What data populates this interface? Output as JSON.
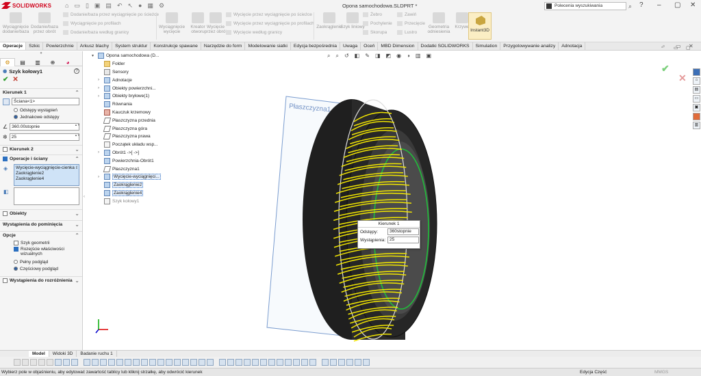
{
  "app": {
    "logo_text": "SOLIDWORKS",
    "doc_title": "Opona samochodowa.SLDPRT *"
  },
  "search": {
    "placeholder": "Polecenia wyszukiwania"
  },
  "ribbon": {
    "b1": "Wyciągnięcie dodanie/baza",
    "b2": "Dodanie/baza przez obrót",
    "s1": "Dodanie/baza przez wyciągnięcie po ścieżce",
    "s2": "Wyciągnięcie po profilach",
    "s3": "Dodanie/baza według granicy",
    "b3": "Wyciągnięcie wycięcie",
    "b4": "Kreator otworu",
    "b5": "Wycięcie przez obrót",
    "s4": "Wycięcie przez wyciągnięcie po ścieżce",
    "s5": "Wycięcie przez wyciągnięcie po profilach",
    "s6": "Wycięcie według granicy",
    "b6": "Zaokrąglenie",
    "b7": "Szyk liniowy",
    "s7": "Żebro",
    "s8": "Pochylenie",
    "s9": "Skorupa",
    "s10": "Zawiń",
    "s11": "Przecięcie",
    "s12": "Lustro",
    "b8": "Geometria odniesienia",
    "b9": "Krzywe",
    "instant3d": "Instant3D"
  },
  "command_tabs": [
    "Operacje",
    "Szkic",
    "Powierzchnie",
    "Arkusz blachy",
    "System struktur",
    "Konstrukcje spawane",
    "Narzędzie do form",
    "Modelowanie siatki",
    "Edycja bezpośrednia",
    "Uwaga",
    "Oceń",
    "MBD Dimension",
    "Dodatki SOLIDWORKS",
    "Simulation",
    "Przygotowywanie analizy",
    "Adnotacja"
  ],
  "property_manager": {
    "title": "Szyk kołowy1",
    "direction1": {
      "header": "Kierunek 1",
      "axis": "Ściana<1>",
      "radio_spacing": "Odstępy wystąpień",
      "radio_equal": "Jednakowe odstępy",
      "angle": "360.00stopnie",
      "count": "25"
    },
    "direction2": {
      "header": "Kierunek 2"
    },
    "features": {
      "header": "Operacje i ściany",
      "items": [
        "Wycięcie-wyciągnięcie-cienka ści",
        "Zaokrąglenie2",
        "Zaokrąglenie4"
      ]
    },
    "bodies": "Obiekty",
    "skip": "Wystąpienia do pominięcia",
    "options": {
      "header": "Opcje",
      "geometry_pattern": "Szyk geometrii",
      "propagate": "Rozejście właściwości wizualnych",
      "full_preview": "Pełny podgląd",
      "partial_preview": "Częściowy podgląd"
    },
    "vary": "Wystąpienia do rozróżnienia"
  },
  "tree": {
    "root": "Opona samochodowa (D...",
    "items": [
      "Folder",
      "Sensory",
      "Adnotacje",
      "Obiekty powierzchni...",
      "Obiekty bryłowe(1)",
      "Równania",
      "Kauczuk krzemowy",
      "Płaszczyzna przednia",
      "Płaszczyzna góra",
      "Płaszczyzna prawa",
      "Początek układu wsp...",
      "Obrót1 ->[ ->]",
      "Powierzchnia-Obrót1",
      "Płaszczyzna1",
      "Wycięcie-wyciągnięci...",
      "Zaokrąglenie2",
      "Zaokrąglenie4",
      "Szyk kołowy1"
    ]
  },
  "viewport": {
    "plane_label": "Płaszczyzna1"
  },
  "callout": {
    "title": "Kierunek 1",
    "spacing_label": "Odstępy:",
    "spacing_value": "360stopnie",
    "count_label": "Wystąpienia:",
    "count_value": "25"
  },
  "model_tabs": [
    "Model",
    "Widoki 3D",
    "Badanie ruchu 1"
  ],
  "status": {
    "message": "Wybierz pole w objaśnieniu, aby edytować zawartość tablicy lub kliknij strzałkę, aby odwrócić kierunek",
    "mode": "Edycja Część",
    "units": "MMGS"
  },
  "colors": {
    "tread_highlight": "#f2e600",
    "ring_highlight": "#1fbf3a",
    "brand": "#d0021b"
  }
}
